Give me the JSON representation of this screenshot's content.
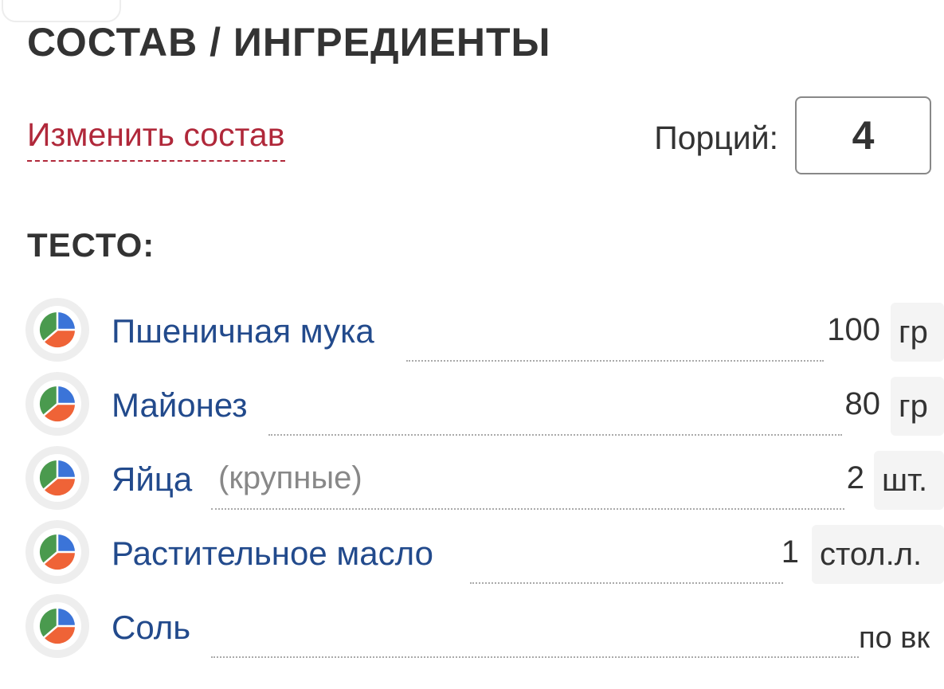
{
  "header": {
    "title": "СОСТАВ / ИНГРЕДИЕНТЫ"
  },
  "controls": {
    "edit_link": "Изменить состав",
    "servings_label": "Порций:",
    "servings_value": "4"
  },
  "group": {
    "title": "ТЕСТО:"
  },
  "ingredients": [
    {
      "name": "Пшеничная мука",
      "note": "",
      "amount": "100",
      "unit": "гр"
    },
    {
      "name": "Майонез",
      "note": "",
      "amount": "80",
      "unit": "гр"
    },
    {
      "name": "Яйца",
      "note": "(крупные)",
      "amount": "2",
      "unit": "шт."
    },
    {
      "name": "Растительное масло",
      "note": "",
      "amount": "1",
      "unit": "стол.л."
    },
    {
      "name": "Соль",
      "note": "",
      "amount": "по вк",
      "unit": ""
    }
  ],
  "icon": {
    "name": "nutrition-pie-icon",
    "colors": {
      "green": "#4a9a4e",
      "blue": "#3b74d8",
      "orange": "#ef6337"
    }
  },
  "colors": {
    "title": "#333333",
    "link": "#b0283a",
    "ingredient": "#224a8c",
    "note": "#888888"
  }
}
